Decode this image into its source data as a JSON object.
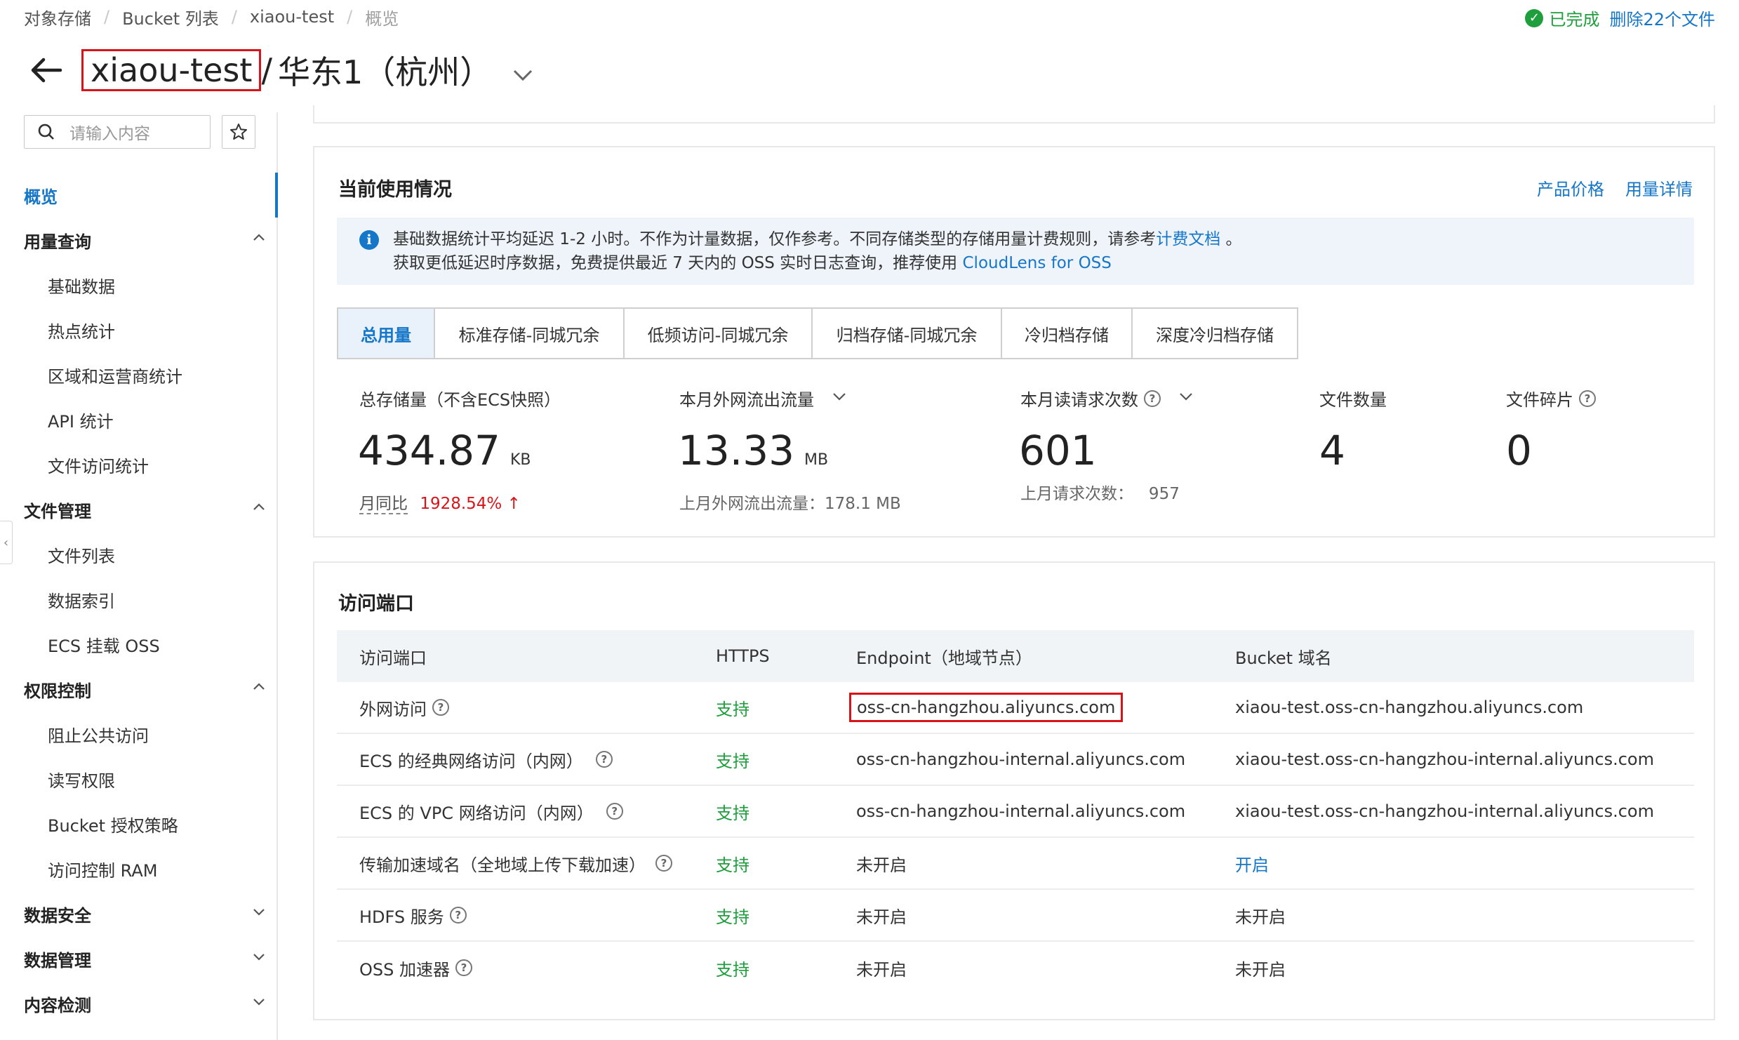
{
  "breadcrumb": [
    "对象存储",
    "Bucket 列表",
    "xiaou-test",
    "概览"
  ],
  "status": {
    "icon": "check-circle-icon",
    "text": "已完成",
    "link": "删除22个文件"
  },
  "title": {
    "bucket": "xiaou-test",
    "separator": "/",
    "region": "华东1（杭州）"
  },
  "search": {
    "placeholder": "请输入内容"
  },
  "sidebar": {
    "overview": "概览",
    "groups": [
      {
        "label": "用量查询",
        "expanded": true,
        "items": [
          "基础数据",
          "热点统计",
          "区域和运营商统计",
          "API 统计",
          "文件访问统计"
        ]
      },
      {
        "label": "文件管理",
        "expanded": true,
        "items": [
          "文件列表",
          "数据索引",
          "ECS 挂载 OSS"
        ]
      },
      {
        "label": "权限控制",
        "expanded": true,
        "items": [
          "阻止公共访问",
          "读写权限",
          "Bucket 授权策略",
          "访问控制 RAM"
        ]
      },
      {
        "label": "数据安全",
        "expanded": false,
        "items": []
      },
      {
        "label": "数据管理",
        "expanded": false,
        "items": []
      },
      {
        "label": "内容检测",
        "expanded": false,
        "items": []
      }
    ]
  },
  "usage": {
    "title": "当前使用情况",
    "links": [
      "产品价格",
      "用量详情"
    ],
    "notice": {
      "line1": "基础数据统计平均延迟 1-2 小时。不作为计量数据，仅作参考。不同存储类型的存储用量计费规则，请参考",
      "line1_link": "计费文档",
      "line1_end": " 。",
      "line2": "获取更低延迟时序数据，免费提供最近 7 天内的 OSS 实时日志查询，推荐使用",
      "line2_link": "CloudLens for OSS"
    },
    "tabs": [
      "总用量",
      "标准存储-同城冗余",
      "低频访问-同城冗余",
      "归档存储-同城冗余",
      "冷归档存储",
      "深度冷归档存储"
    ],
    "metrics": {
      "storage": {
        "label": "总存储量（不含ECS快照）",
        "value": "434.87",
        "unit": "KB",
        "sub_label": "月同比",
        "sub_value": "1928.54%",
        "arrow": "↑"
      },
      "traffic": {
        "label": "本月外网流出流量",
        "value": "13.33",
        "unit": "MB",
        "sub": "上月外网流出流量：178.1 MB"
      },
      "requests": {
        "label": "本月读请求次数",
        "value": "601",
        "sub": "上月请求次数：   957"
      },
      "files": {
        "label": "文件数量",
        "value": "4"
      },
      "fragments": {
        "label": "文件碎片",
        "value": "0"
      }
    }
  },
  "access": {
    "title": "访问端口",
    "columns": [
      "访问端口",
      "HTTPS",
      "Endpoint（地域节点）",
      "Bucket 域名"
    ],
    "rows": [
      {
        "name": "外网访问",
        "https": "支持",
        "endpoint": "oss-cn-hangzhou.aliyuncs.com",
        "domain": "xiaou-test.oss-cn-hangzhou.aliyuncs.com"
      },
      {
        "name": "ECS 的经典网络访问（内网）",
        "https": "支持",
        "endpoint": "oss-cn-hangzhou-internal.aliyuncs.com",
        "domain": "xiaou-test.oss-cn-hangzhou-internal.aliyuncs.com"
      },
      {
        "name": "ECS 的 VPC 网络访问（内网）",
        "https": "支持",
        "endpoint": "oss-cn-hangzhou-internal.aliyuncs.com",
        "domain": "xiaou-test.oss-cn-hangzhou-internal.aliyuncs.com"
      },
      {
        "name": "传输加速域名（全地域上传下载加速）",
        "https": "支持",
        "endpoint": "未开启",
        "domain": "开启"
      },
      {
        "name": "HDFS 服务",
        "https": "支持",
        "endpoint": "未开启",
        "domain": "未开启"
      },
      {
        "name": "OSS 加速器",
        "https": "支持",
        "endpoint": "未开启",
        "domain": "未开启"
      }
    ]
  },
  "colors": {
    "accent": "#1677c8",
    "success": "#1e9e3c",
    "danger": "#d8141a"
  }
}
